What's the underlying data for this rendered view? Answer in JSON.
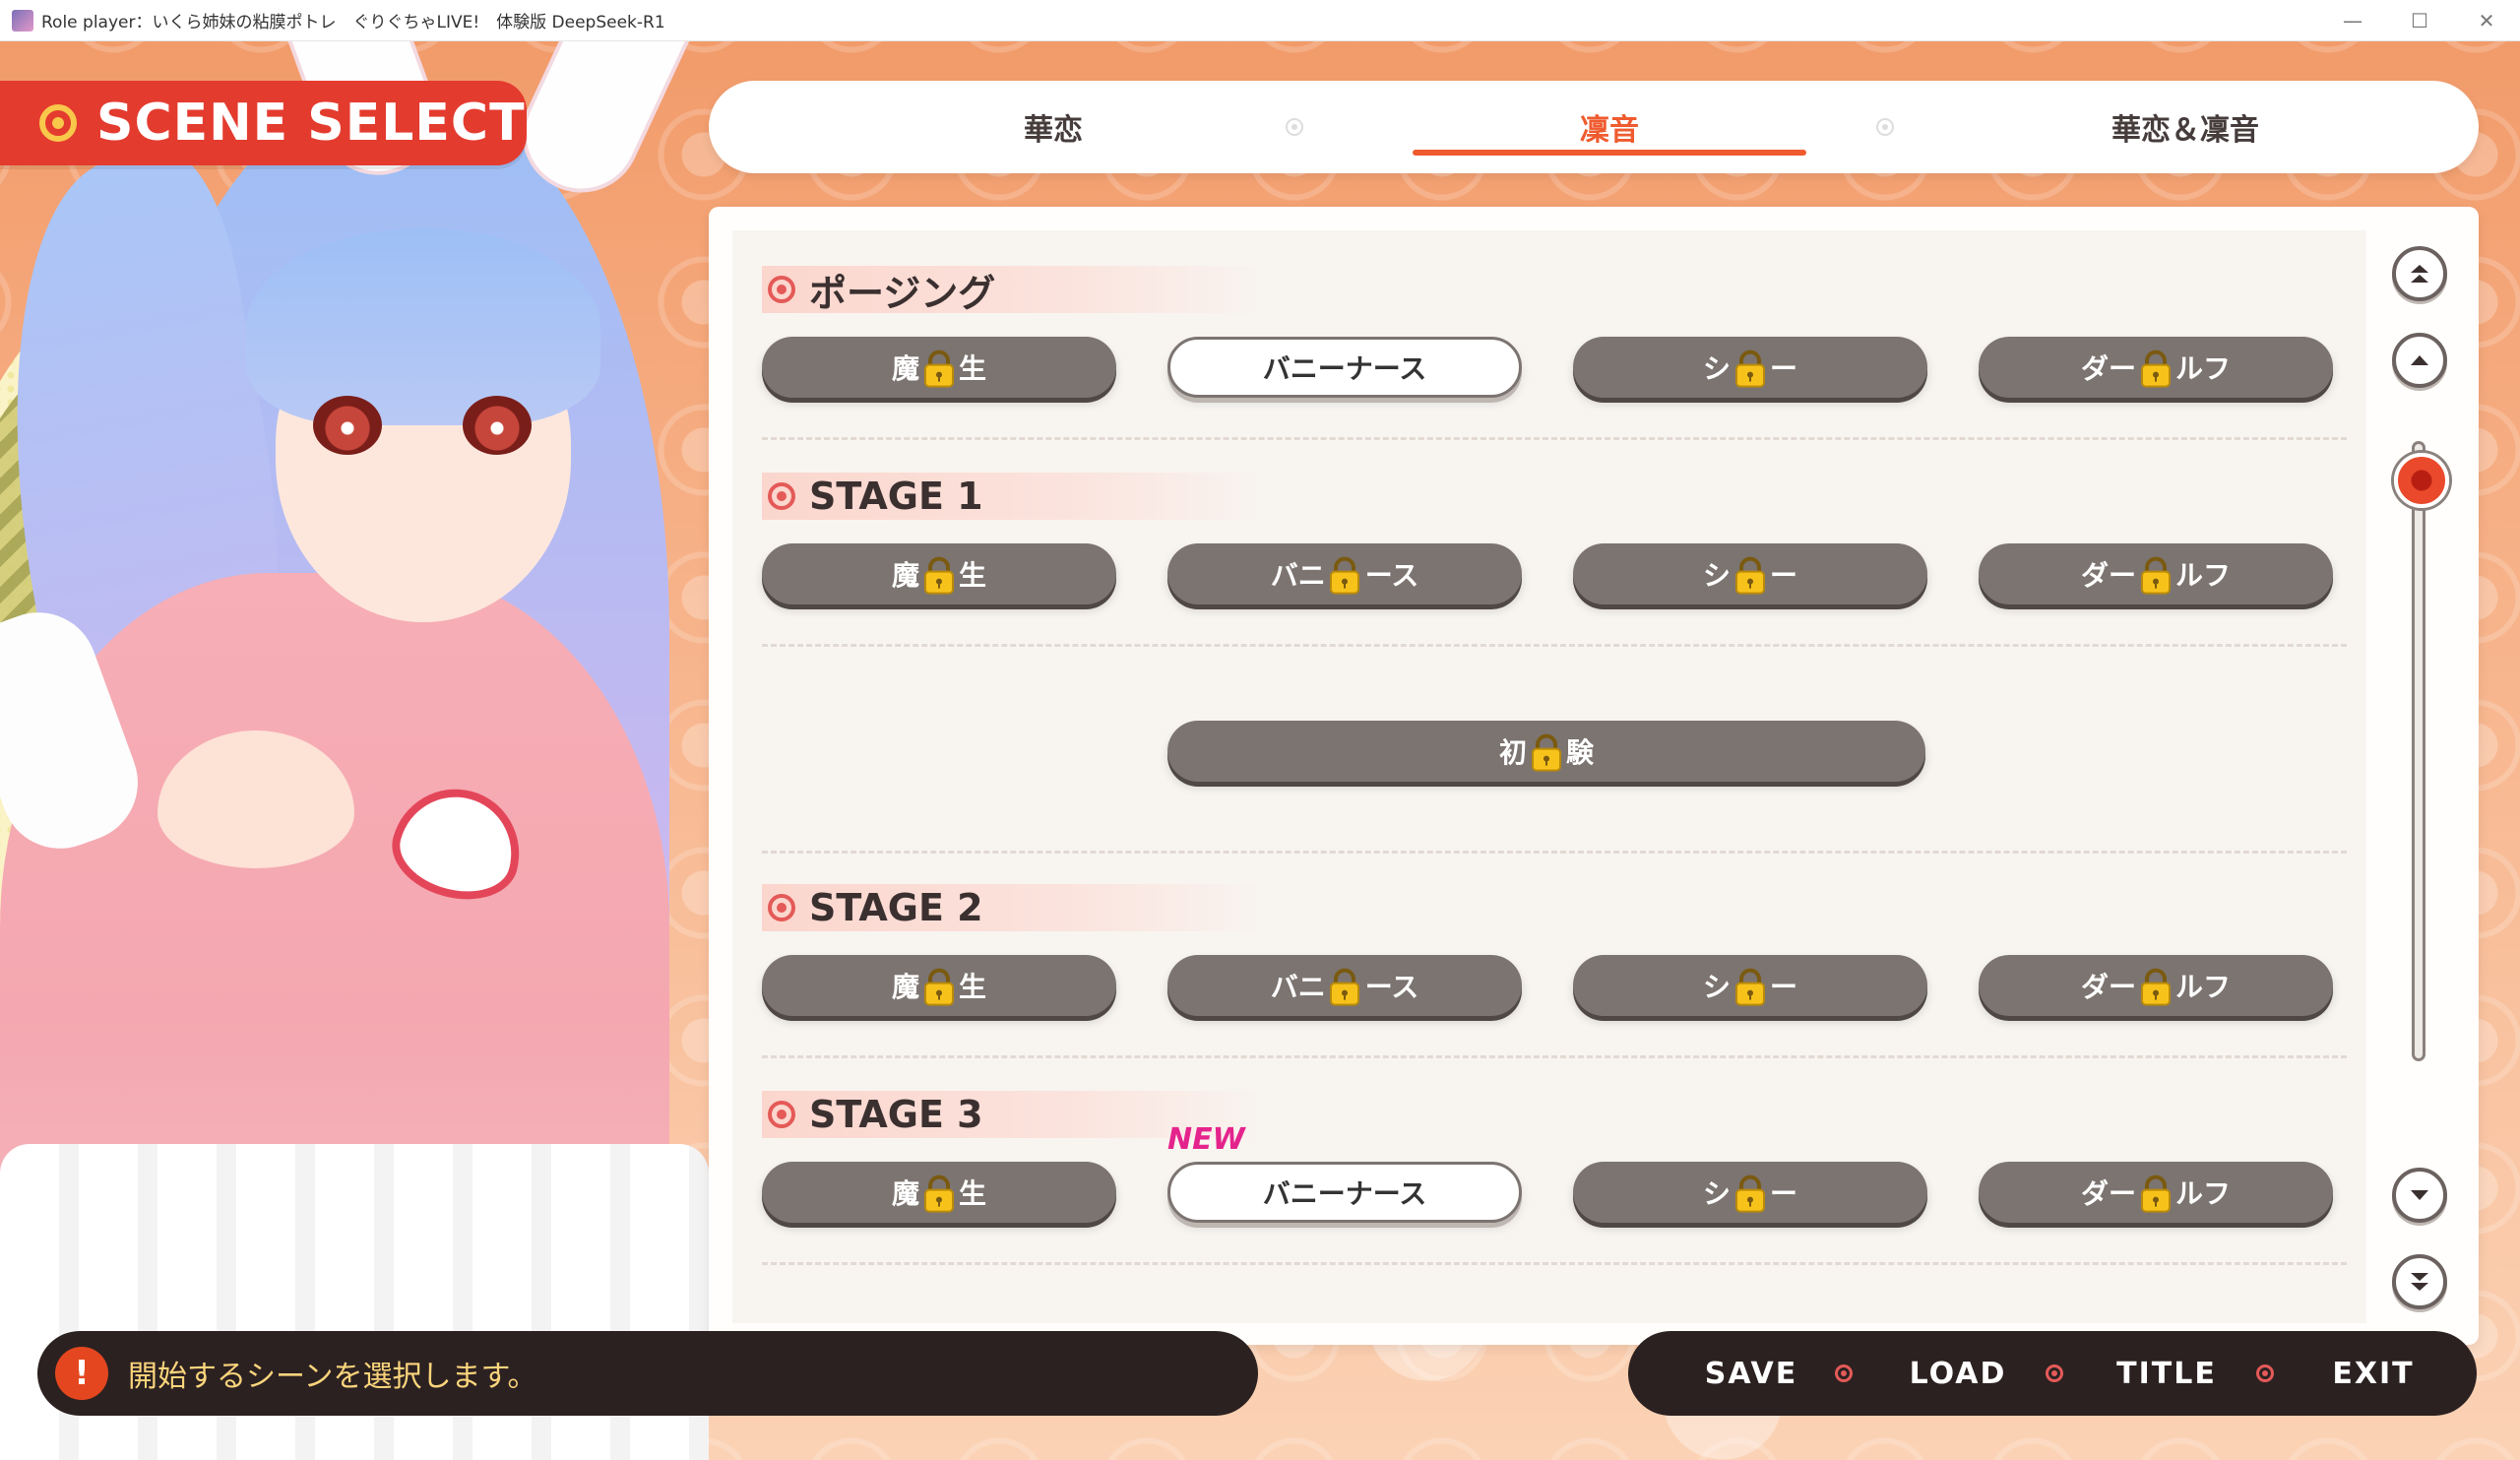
{
  "window": {
    "title": "Role player：いくら姉妹の粘膜ポトレ　ぐりぐちゃLIVE!　体験版 DeepSeek-R1",
    "controls": [
      "—",
      "☐",
      "✕"
    ]
  },
  "header": {
    "title": "SCENE SELECT"
  },
  "tabs": [
    {
      "label": "華恋",
      "active": false
    },
    {
      "label": "凜音",
      "active": true
    },
    {
      "label": "華恋＆凜音",
      "active": false
    }
  ],
  "sections": [
    {
      "title": "ポージング",
      "buttons": [
        {
          "left": "魔",
          "right": "生",
          "locked": true
        },
        {
          "label": "バニーナース",
          "locked": false
        },
        {
          "left": "シ",
          "right": "ー",
          "locked": true
        },
        {
          "left": "ダー",
          "right": "ルフ",
          "locked": true
        }
      ]
    },
    {
      "title": "STAGE 1",
      "buttons": [
        {
          "left": "魔",
          "right": "生",
          "locked": true
        },
        {
          "left": "バニ",
          "right": "ース",
          "locked": true
        },
        {
          "left": "シ",
          "right": "ー",
          "locked": true
        },
        {
          "left": "ダー",
          "right": "ルフ",
          "locked": true
        }
      ],
      "wide_button": {
        "left": "初",
        "right": "験",
        "locked": true
      }
    },
    {
      "title": "STAGE 2",
      "buttons": [
        {
          "left": "魔",
          "right": "生",
          "locked": true
        },
        {
          "left": "バニ",
          "right": "ース",
          "locked": true
        },
        {
          "left": "シ",
          "right": "ー",
          "locked": true
        },
        {
          "left": "ダー",
          "right": "ルフ",
          "locked": true
        }
      ]
    },
    {
      "title": "STAGE 3",
      "buttons": [
        {
          "left": "魔",
          "right": "生",
          "locked": true
        },
        {
          "label": "バニーナース",
          "locked": false,
          "new_tag": "NEW"
        },
        {
          "left": "シ",
          "right": "ー",
          "locked": true
        },
        {
          "left": "ダー",
          "right": "ルフ",
          "locked": true
        }
      ]
    }
  ],
  "scrollbar": {
    "icons": [
      "scroll-top-icon",
      "scroll-up-icon",
      "scroll-down-icon",
      "scroll-bottom-icon"
    ],
    "position": 0
  },
  "status": {
    "icon": "!",
    "message": "開始するシーンを選択します。"
  },
  "menu": [
    {
      "label": "SAVE"
    },
    {
      "label": "LOAD"
    },
    {
      "label": "TITLE"
    },
    {
      "label": "EXIT"
    }
  ],
  "colors": {
    "accent": "#ef5b2f",
    "header_red": "#e43b2f",
    "locked_button": "#7c7470",
    "new_tag": "#e4238c",
    "message_text": "#fbd57c"
  }
}
